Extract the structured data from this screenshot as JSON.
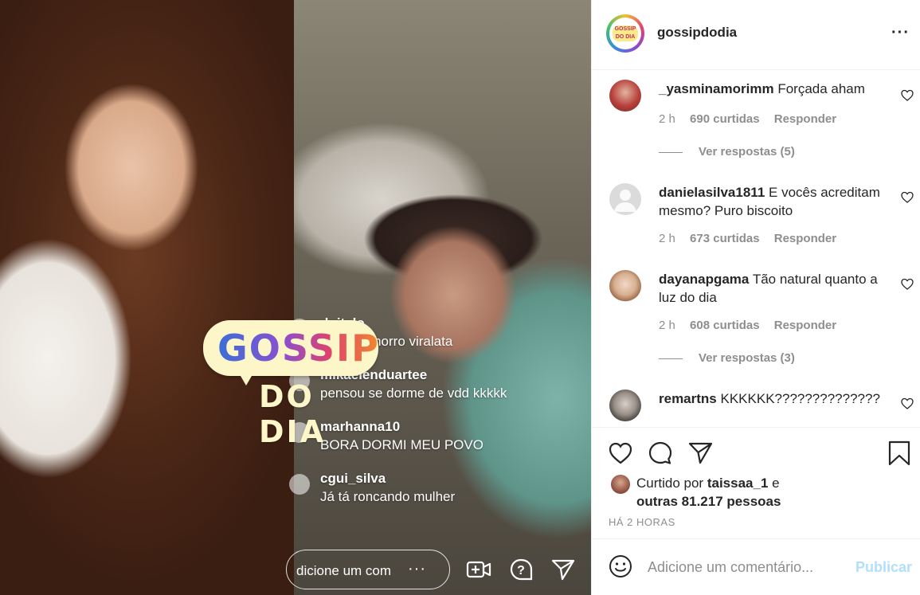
{
  "post": {
    "logo": {
      "top": "GOSSIP",
      "bottom": "DO DIA"
    },
    "live_comments": [
      {
        "user": "doitalo",
        "text": "esse cachorro viralata"
      },
      {
        "user": "mikaelenduartee",
        "text": "pensou se dorme de vdd kkkkk"
      },
      {
        "user": "marhanna10",
        "text": "BORA DORMI MEU POVO"
      },
      {
        "user": "cgui_silva",
        "text": "Já tá roncando mulher"
      }
    ],
    "live_input_placeholder": "dicione um com",
    "live_more": "···"
  },
  "header": {
    "username": "gossipdodia",
    "more": "···",
    "avatar_text": "GOSSIP DO DIA"
  },
  "comments": [
    {
      "user": "_yasminamorimm",
      "text": "Forçada aham",
      "time": "2 h",
      "likes": "690 curtidas",
      "reply": "Responder",
      "replies": "Ver respostas (5)"
    },
    {
      "user": "danielasilva1811",
      "text": "E vocês acreditam mesmo? Puro biscoito",
      "time": "2 h",
      "likes": "673 curtidas",
      "reply": "Responder"
    },
    {
      "user": "dayanapgama",
      "text": "Tão natural quanto a luz do dia",
      "time": "2 h",
      "likes": "608 curtidas",
      "reply": "Responder",
      "replies": "Ver respostas (3)"
    },
    {
      "user": "remartns",
      "text": "KKKKKK??????????????"
    }
  ],
  "likes": {
    "prefix": "Curtido por",
    "user": "taissaa_1",
    "joiner": "e",
    "others": "outras 81.217 pessoas"
  },
  "timestamp": "HÁ 2 HORAS",
  "comment_box": {
    "placeholder": "Adicione um comentário...",
    "publish": "Publicar"
  }
}
